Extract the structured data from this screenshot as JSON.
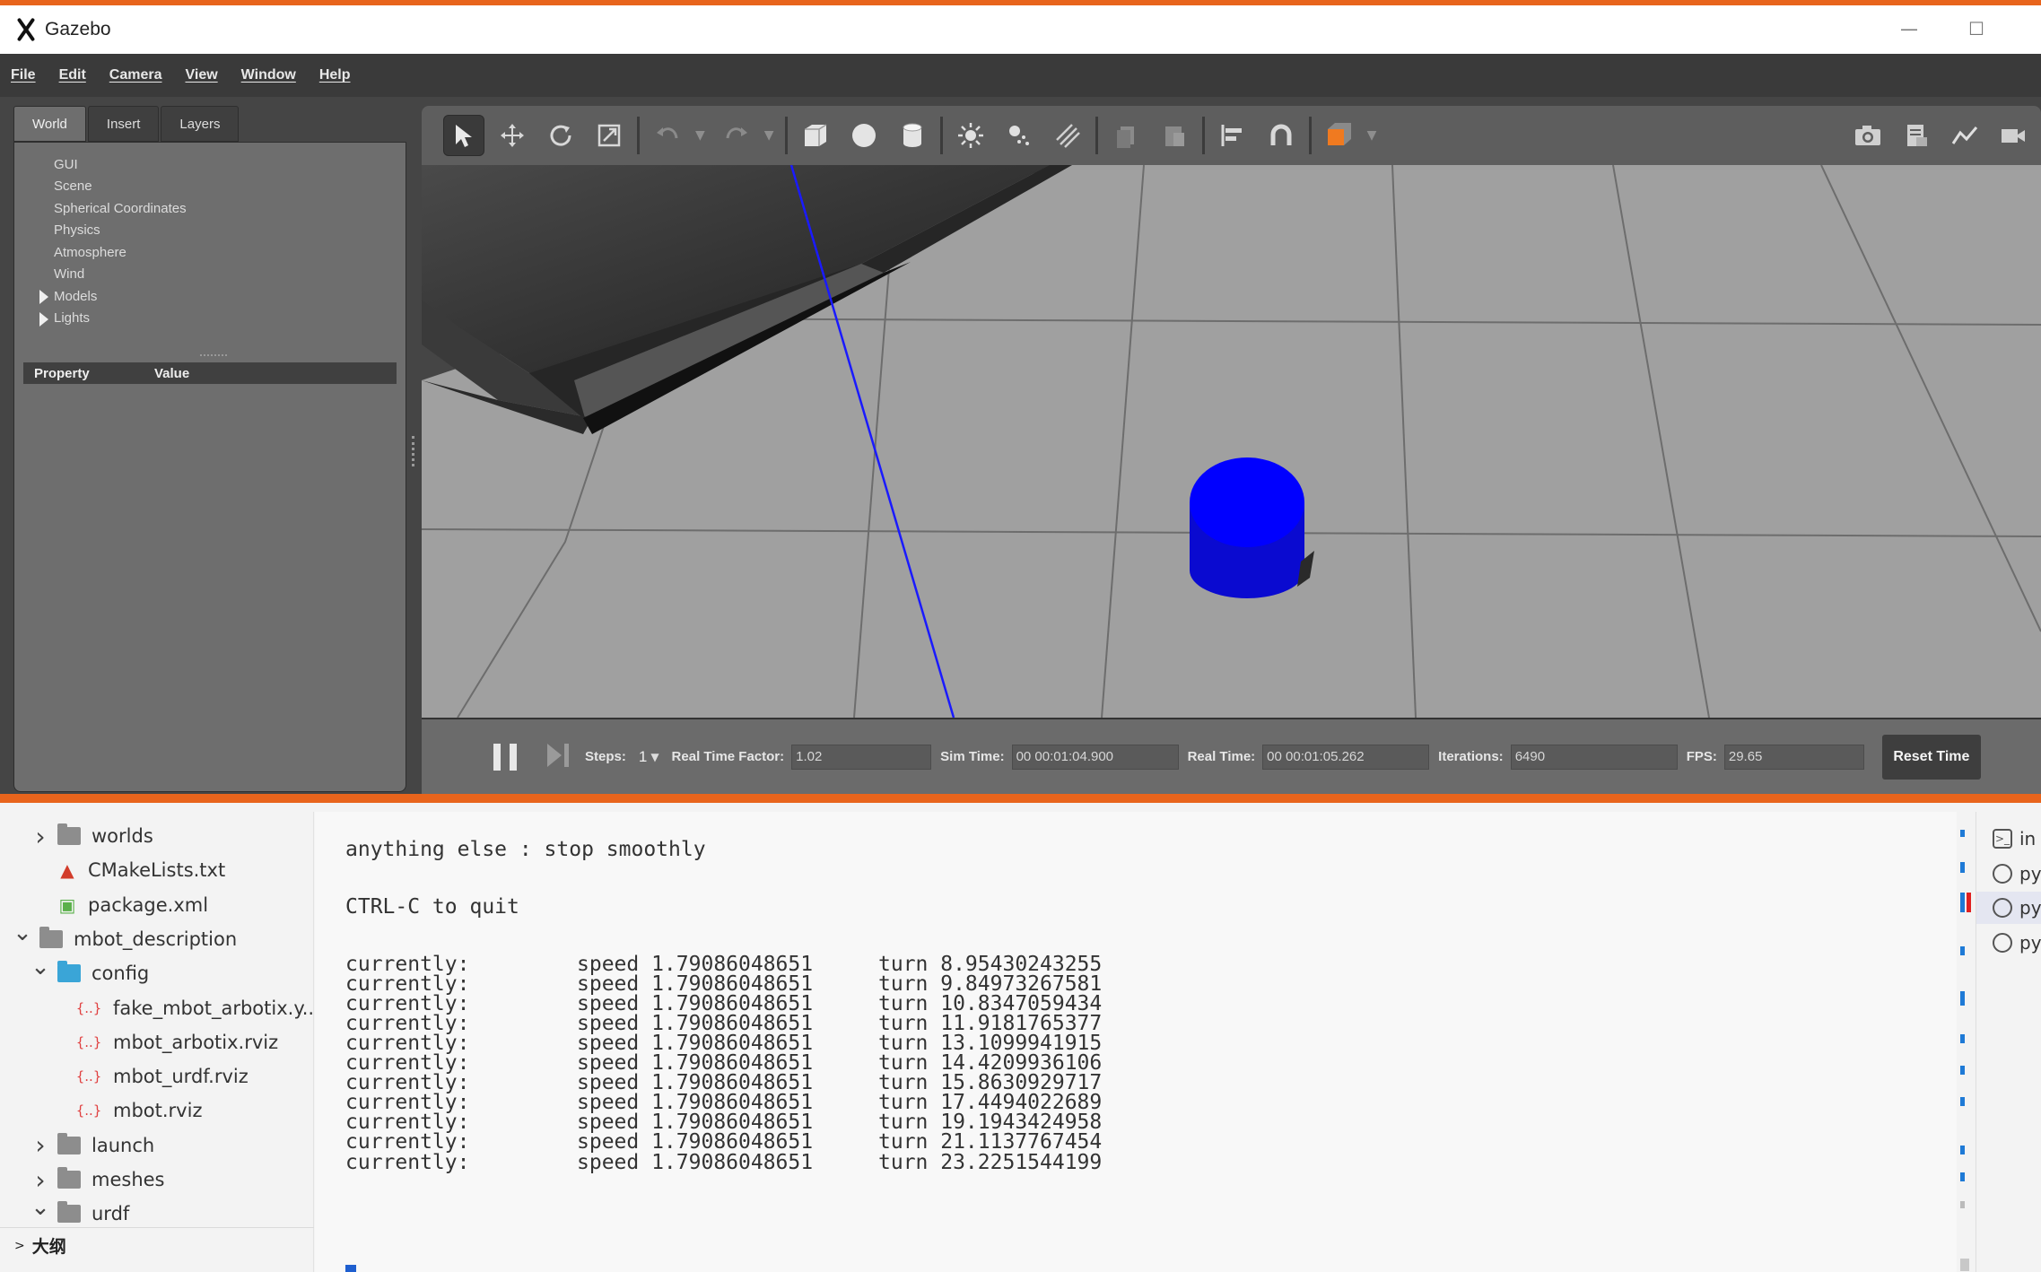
{
  "window": {
    "title": "Gazebo"
  },
  "menu": [
    "File",
    "Edit",
    "Camera",
    "View",
    "Window",
    "Help"
  ],
  "left_tabs": [
    "World",
    "Insert",
    "Layers"
  ],
  "world_tree": [
    {
      "label": "GUI",
      "expandable": false
    },
    {
      "label": "Scene",
      "expandable": false
    },
    {
      "label": "Spherical Coordinates",
      "expandable": false
    },
    {
      "label": "Physics",
      "expandable": false
    },
    {
      "label": "Atmosphere",
      "expandable": false
    },
    {
      "label": "Wind",
      "expandable": false
    },
    {
      "label": "Models",
      "expandable": true
    },
    {
      "label": "Lights",
      "expandable": true
    }
  ],
  "property_table": {
    "col1": "Property",
    "col2": "Value"
  },
  "toolbar": {
    "tools": [
      "select-tool",
      "translate-tool",
      "rotate-tool",
      "scale-tool",
      "undo",
      "redo",
      "box-shape",
      "sphere-shape",
      "cylinder-shape",
      "point-light",
      "spot-light",
      "directional-light",
      "copy",
      "paste",
      "align",
      "snap",
      "view-angle"
    ],
    "right_tools": [
      "screenshot",
      "log-data",
      "plot",
      "record-video"
    ]
  },
  "timebar": {
    "steps_label": "Steps:",
    "steps_value": "1",
    "rtf_label": "Real Time Factor:",
    "rtf_value": "1.02",
    "sim_time_label": "Sim Time:",
    "sim_time_value": "00 00:01:04.900",
    "real_time_label": "Real Time:",
    "real_time_value": "00 00:01:05.262",
    "iterations_label": "Iterations:",
    "iterations_value": "6490",
    "fps_label": "FPS:",
    "fps_value": "29.65",
    "reset_label": "Reset Time"
  },
  "explorer": {
    "rows": [
      {
        "label": "worlds",
        "type": "folder",
        "depth": 1,
        "chevron": ">"
      },
      {
        "label": "CMakeLists.txt",
        "type": "cmake",
        "depth": 1,
        "chevron": ""
      },
      {
        "label": "package.xml",
        "type": "xml",
        "depth": 1,
        "chevron": ""
      },
      {
        "label": "mbot_description",
        "type": "folder",
        "depth": 0,
        "chevron": "v"
      },
      {
        "label": "config",
        "type": "folder-config",
        "depth": 1,
        "chevron": "v"
      },
      {
        "label": "fake_mbot_arbotix.y...",
        "type": "json",
        "depth": 2,
        "chevron": ""
      },
      {
        "label": "mbot_arbotix.rviz",
        "type": "json",
        "depth": 2,
        "chevron": ""
      },
      {
        "label": "mbot_urdf.rviz",
        "type": "json",
        "depth": 2,
        "chevron": ""
      },
      {
        "label": "mbot.rviz",
        "type": "json",
        "depth": 2,
        "chevron": ""
      },
      {
        "label": "launch",
        "type": "folder",
        "depth": 1,
        "chevron": ">"
      },
      {
        "label": "meshes",
        "type": "folder",
        "depth": 1,
        "chevron": ">"
      },
      {
        "label": "urdf",
        "type": "folder",
        "depth": 1,
        "chevron": "v"
      }
    ],
    "outline_label": "大纲"
  },
  "terminal": {
    "intro": [
      "anything else : stop smoothly",
      "CTRL-C to quit"
    ],
    "rows": [
      {
        "label": "currently:",
        "speed": "speed 1.79086048651",
        "turn": "turn 8.95430243255"
      },
      {
        "label": "currently:",
        "speed": "speed 1.79086048651",
        "turn": "turn 9.84973267581"
      },
      {
        "label": "currently:",
        "speed": "speed 1.79086048651",
        "turn": "turn 10.8347059434"
      },
      {
        "label": "currently:",
        "speed": "speed 1.79086048651",
        "turn": "turn 11.9181765377"
      },
      {
        "label": "currently:",
        "speed": "speed 1.79086048651",
        "turn": "turn 13.1099941915"
      },
      {
        "label": "currently:",
        "speed": "speed 1.79086048651",
        "turn": "turn 14.4209936106"
      },
      {
        "label": "currently:",
        "speed": "speed 1.79086048651",
        "turn": "turn 15.8630929717"
      },
      {
        "label": "currently:",
        "speed": "speed 1.79086048651",
        "turn": "turn 17.4494022689"
      },
      {
        "label": "currently:",
        "speed": "speed 1.79086048651",
        "turn": "turn 19.1943424958"
      },
      {
        "label": "currently:",
        "speed": "speed 1.79086048651",
        "turn": "turn 21.1137767454"
      },
      {
        "label": "currently:",
        "speed": "speed 1.79086048651",
        "turn": "turn 23.2251544199"
      }
    ]
  },
  "right_panel": [
    {
      "label": "in",
      "icon": "terminal-icon"
    },
    {
      "label": "py",
      "icon": "python-icon"
    },
    {
      "label": "py",
      "icon": "python-icon"
    },
    {
      "label": "py",
      "icon": "python-icon"
    }
  ],
  "colors": {
    "accent": "#e8641c",
    "robot": "#0000ff",
    "ground": "#a0a0a0",
    "explorer_json_icon": "#e04040"
  }
}
